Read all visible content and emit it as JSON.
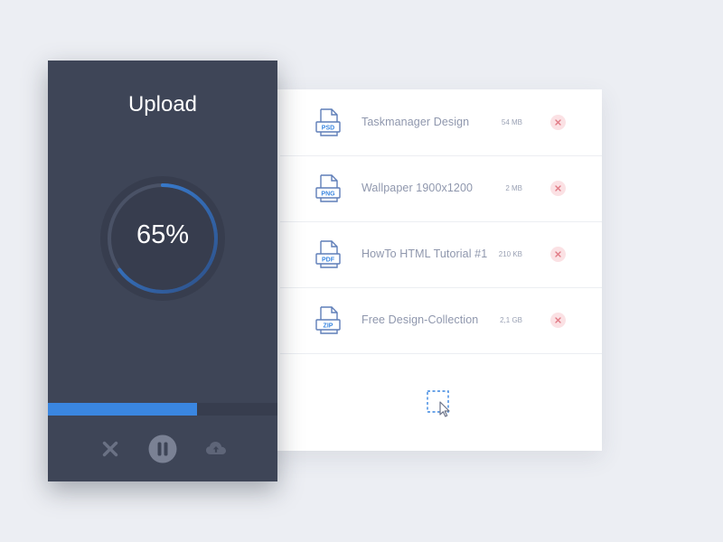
{
  "upload": {
    "title": "Upload",
    "progress_label": "65%",
    "progress": 0.65,
    "controls": {
      "cancel_icon": "close-icon",
      "pause_icon": "pause-icon",
      "cloud_icon": "cloud-upload-icon"
    }
  },
  "files": [
    {
      "type": "PSD",
      "name": "Taskmanager Design",
      "size": "54 MB"
    },
    {
      "type": "PNG",
      "name": "Wallpaper 1900x1200",
      "size": "2 MB"
    },
    {
      "type": "PDF",
      "name": "HowTo HTML Tutorial #1",
      "size": "210 KB"
    },
    {
      "type": "ZIP",
      "name": "Free Design-Collection",
      "size": "2,1 GB"
    }
  ],
  "dropzone": {
    "icon": "drag-select-icon"
  },
  "colors": {
    "accent": "#3a86e0",
    "card": "#3e4557",
    "remove": "#fbe1e4",
    "remove_x": "#e07a85",
    "file_icon": "#5f7eb8"
  }
}
